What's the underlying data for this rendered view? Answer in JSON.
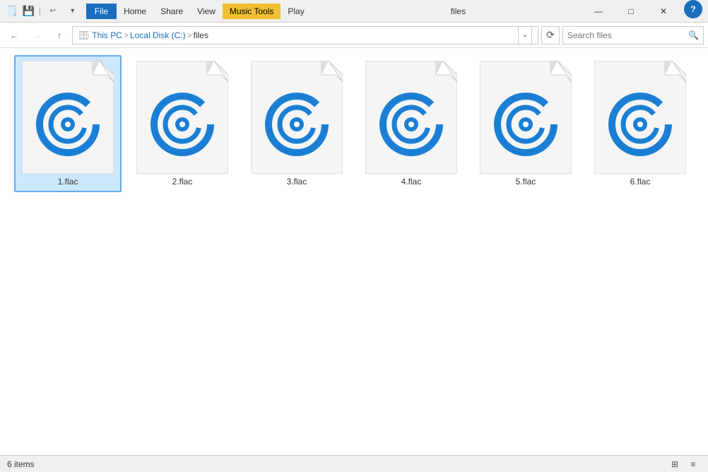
{
  "titleBar": {
    "appTitle": "files",
    "quickAccessButtons": [
      "📁",
      "↩",
      "▾"
    ],
    "tabs": [
      {
        "label": "File",
        "active": false,
        "highlighted": false,
        "id": "file"
      },
      {
        "label": "Home",
        "active": false,
        "highlighted": false,
        "id": "home"
      },
      {
        "label": "Share",
        "active": false,
        "highlighted": false,
        "id": "share"
      },
      {
        "label": "View",
        "active": false,
        "highlighted": false,
        "id": "view"
      },
      {
        "label": "Play",
        "active": false,
        "highlighted": false,
        "id": "play"
      }
    ],
    "ribbonLabel": "Music Tools",
    "controls": {
      "minimize": "—",
      "maximize": "□",
      "close": "✕"
    }
  },
  "addressBar": {
    "backDisabled": false,
    "forwardDisabled": true,
    "upLabel": "↑",
    "breadcrumbs": [
      {
        "label": "This PC",
        "link": true
      },
      {
        "label": "Local Disk (C:)",
        "link": true
      },
      {
        "label": "files",
        "link": false
      }
    ],
    "searchPlaceholder": "Search files",
    "searchLabel": "Search"
  },
  "files": [
    {
      "name": "1.flac",
      "selected": true
    },
    {
      "name": "2.flac",
      "selected": false
    },
    {
      "name": "3.flac",
      "selected": false
    },
    {
      "name": "4.flac",
      "selected": false
    },
    {
      "name": "5.flac",
      "selected": false
    },
    {
      "name": "6.flac",
      "selected": false
    }
  ],
  "statusBar": {
    "itemCount": "6 items"
  }
}
